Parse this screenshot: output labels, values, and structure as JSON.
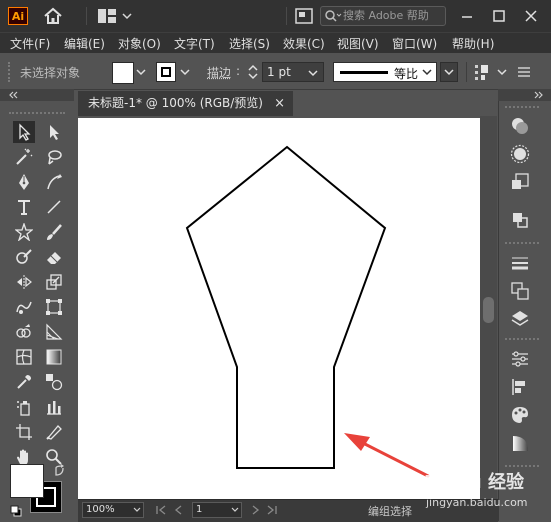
{
  "app": {
    "logo_text": "Ai",
    "search_placeholder": "搜索 Adobe 帮助"
  },
  "menu": [
    "文件(F)",
    "编辑(E)",
    "对象(O)",
    "文字(T)",
    "选择(S)",
    "效果(C)",
    "视图(V)",
    "窗口(W)",
    "帮助(H)"
  ],
  "control_bar": {
    "selection_status": "未选择对象",
    "stroke_label": "描边",
    "stroke_weight": "1 pt",
    "stroke_profile": "等比"
  },
  "document": {
    "tab_title": "未标题-1* @ 100% (RGB/预览)",
    "close_glyph": "×"
  },
  "status": {
    "zoom": "100%",
    "page": "1",
    "tool_status": "编组选择"
  },
  "colors": {
    "fill": "#ffffff",
    "stroke": "#000000",
    "annotation_arrow": "#e8423a",
    "ai_orange": "#ff9a00"
  },
  "watermark": {
    "brand": "Baidu 经验",
    "url": "jingyan.baidu.com"
  }
}
